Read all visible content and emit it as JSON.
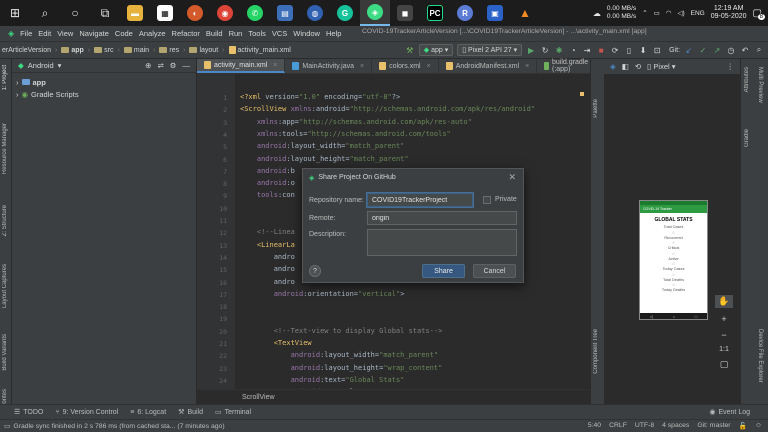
{
  "taskbar": {
    "tray": {
      "upload_speed": "0.00 MB/s",
      "download_speed": "0.00 MB/s",
      "language": "ENG",
      "time": "12:19 AM",
      "date": "09-05-2020",
      "notifications": "8"
    }
  },
  "menubar": {
    "items": [
      "File",
      "Edit",
      "View",
      "Navigate",
      "Code",
      "Analyze",
      "Refactor",
      "Build",
      "Run",
      "Tools",
      "VCS",
      "Window",
      "Help"
    ],
    "window_title": "COVID-19TrackerArticleVersion [...\\COVID19TrackerArticleVersion] - ...\\activity_main.xml [app]"
  },
  "navbar": {
    "crumbs": [
      "erArticleVersion",
      "app",
      "src",
      "main",
      "res",
      "layout",
      "activity_main.xml"
    ],
    "run_config": "app",
    "device": "Pixel 2 API 27",
    "git_label": "Git:"
  },
  "project": {
    "view_label": "Android",
    "tree": [
      {
        "label": "app",
        "bold": true
      },
      {
        "label": "Gradle Scripts",
        "bold": false
      }
    ]
  },
  "left_stripe": [
    "1: Project",
    "Resource Manager",
    "Z: Structure",
    "Layout Captures",
    "Build Variants",
    "2: Favorites"
  ],
  "tabs": [
    {
      "label": "activity_main.xml",
      "active": true,
      "color": "#e8bf6a"
    },
    {
      "label": "MainActivity.java",
      "active": false,
      "color": "#4a9ad6"
    },
    {
      "label": "colors.xml",
      "active": false,
      "color": "#e8bf6a"
    },
    {
      "label": "AndroidManifest.xml",
      "active": false,
      "color": "#e8bf6a"
    },
    {
      "label": "build.gradle (:app)",
      "active": false,
      "color": "#6fb25b"
    }
  ],
  "editor": {
    "line_numbers": [
      "1",
      "2",
      "3",
      "4",
      "5",
      "6",
      "7",
      "8",
      "9",
      "10",
      "11",
      "12",
      "13",
      "14",
      "15",
      "16",
      "17",
      "18",
      "19",
      "20",
      "21",
      "22",
      "23",
      "24",
      "25"
    ],
    "lines": [
      "<?xml version=\"1.0\" encoding=\"utf-8\"?>",
      "<ScrollView xmlns:android=\"http://schemas.android.com/apk/res/android\"",
      "    xmlns:app=\"http://schemas.android.com/apk/res-auto\"",
      "    xmlns:tools=\"http://schemas.android.com/tools\"",
      "    android:layout_width=\"match_parent\"",
      "    android:layout_height=\"match_parent\"",
      "    android:b",
      "    android:o",
      "    tools:con",
      "",
      "",
      "    <!--Linea",
      "    <LinearLa",
      "        andro",
      "        andro",
      "        andro",
      "        android:orientation=\"vertical\">",
      "",
      "",
      "        <!--Text-view to display Global stats-->",
      "        <TextView",
      "            android:layout_width=\"match_parent\"",
      "            android:layout_height=\"wrap_content\"",
      "            android:text=\"Global Stats\"",
      "            android:textColor=\"#050505\""
    ],
    "footer_label": "ScrollView"
  },
  "design": {
    "device_label": "Pixel",
    "right_stripe": [
      "Attributes",
      "Gradle",
      "Device File Explorer"
    ],
    "top_right_stripe": "Multi Preview",
    "palette_label": "Palette",
    "component_tree_label": "Component Tree",
    "zoom_ratio": "1:1"
  },
  "phone": {
    "app_title": "COVID-19 Tracker",
    "global_title": "GLOBAL STATS",
    "stats": [
      "Total Cases",
      "Recovered",
      "Critical",
      "Active",
      "Today Cases",
      "Total Deaths",
      "Today Deaths"
    ],
    "value_placeholder": "0"
  },
  "dialog": {
    "title": "Share Project On GitHub",
    "repo_label": "Repository name:",
    "repo_value": "COVID19TrackerProject",
    "private_label": "Private",
    "remote_label": "Remote:",
    "remote_value": "origin",
    "description_label": "Description:",
    "description_value": "",
    "help_label": "?",
    "share_label": "Share",
    "cancel_label": "Cancel"
  },
  "toolwindows": {
    "items": [
      "TODO",
      "9: Version Control",
      "6: Logcat",
      "Build",
      "Terminal"
    ],
    "event_log": "Event Log"
  },
  "statusbar": {
    "message": "Gradle sync finished in 2 s 786 ms (from cached sta... (7 minutes ago)",
    "position": "5:40",
    "line_sep": "CRLF",
    "encoding": "UTF-8",
    "indent": "4 spaces",
    "vcs": "Git: master"
  },
  "colors": {
    "accent": "#365880",
    "background": "#2b2b2b",
    "panel": "#3c3f41",
    "phone_appbar": "#2e9b43"
  }
}
